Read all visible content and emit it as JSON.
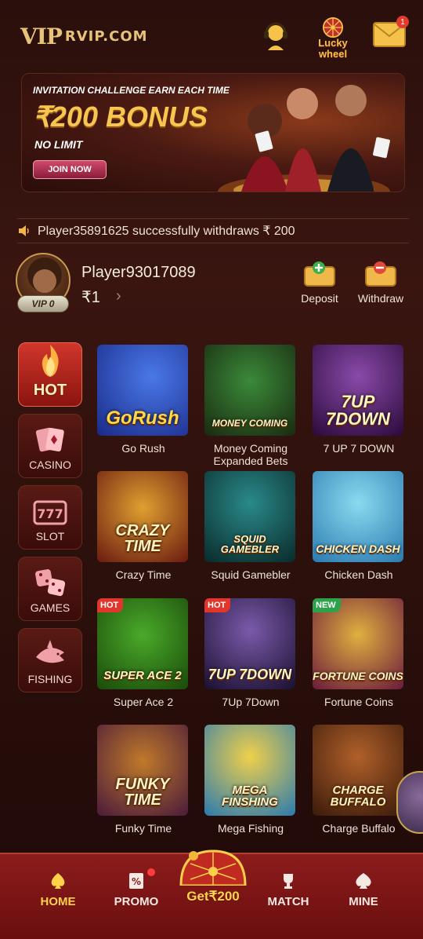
{
  "header": {
    "logo_mark": "VIP",
    "logo_text": "RVIP.COM",
    "lucky_wheel_label_1": "Lucky",
    "lucky_wheel_label_2": "wheel",
    "mail_badge": "1"
  },
  "banner": {
    "kicker": "INVITATION CHALLENGE EARN EACH TIME",
    "bonus": "₹200 BONUS",
    "limit": "NO LIMIT",
    "button": "JOIN NOW"
  },
  "marquee": {
    "text": "Player35891625 successfully withdraws ₹ 200"
  },
  "user": {
    "name": "Player93017089",
    "balance": "₹1",
    "vip": "VIP 0",
    "deposit_label": "Deposit",
    "withdraw_label": "Withdraw"
  },
  "categories": [
    {
      "label": "HOT"
    },
    {
      "label": "CASINO"
    },
    {
      "label": "SLOT"
    },
    {
      "label": "GAMES"
    },
    {
      "label": "FISHING"
    }
  ],
  "games": [
    {
      "label": "Go Rush",
      "art": "GoRush",
      "tag": ""
    },
    {
      "label": "Money Coming Expanded Bets",
      "art": "MONEY COMING",
      "tag": ""
    },
    {
      "label": "7 UP 7 DOWN",
      "art": "7UP 7DOWN",
      "tag": ""
    },
    {
      "label": "Crazy Time",
      "art": "CRAZY TIME",
      "tag": ""
    },
    {
      "label": "Squid Gamebler",
      "art": "SQUID GAMEBLER",
      "tag": ""
    },
    {
      "label": "Chicken Dash",
      "art": "CHICKEN DASH",
      "tag": ""
    },
    {
      "label": "Super Ace 2",
      "art": "SUPER ACE 2",
      "tag": "HOT"
    },
    {
      "label": "7Up 7Down",
      "art": "7UP 7DOWN",
      "tag": "HOT"
    },
    {
      "label": "Fortune Coins",
      "art": "FORTUNE COINS",
      "tag": "NEW"
    },
    {
      "label": "Funky Time",
      "art": "FUNKY TIME",
      "tag": ""
    },
    {
      "label": "Mega Fishing",
      "art": "MEGA FINSHING",
      "tag": ""
    },
    {
      "label": "Charge Buffalo",
      "art": "CHARGE BUFFALO",
      "tag": ""
    }
  ],
  "nav": {
    "home": "HOME",
    "promo": "PROMO",
    "get": "Get₹200",
    "match": "MATCH",
    "mine": "MINE"
  },
  "colors": {
    "gold": "#e7c27a",
    "accent_red": "#d0362a",
    "nav_bg": "#8c1c1c",
    "background": "#2a0f0c"
  }
}
